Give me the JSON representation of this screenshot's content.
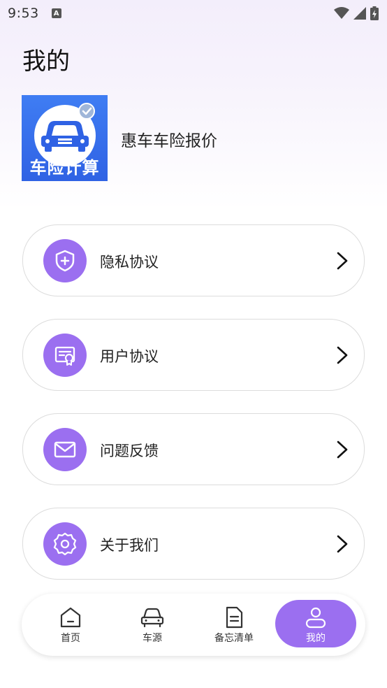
{
  "status_bar": {
    "time": "9:53",
    "notification_icon": "A"
  },
  "page": {
    "title": "我的"
  },
  "app": {
    "logo_text": "车险计算",
    "name": "惠车车险报价"
  },
  "menu": {
    "items": [
      {
        "label": "隐私协议",
        "icon": "shield-plus-icon"
      },
      {
        "label": "用户协议",
        "icon": "certificate-icon"
      },
      {
        "label": "问题反馈",
        "icon": "mail-icon"
      },
      {
        "label": "关于我们",
        "icon": "gear-icon"
      }
    ]
  },
  "bottom_nav": {
    "items": [
      {
        "label": "首页",
        "icon": "home-icon"
      },
      {
        "label": "车源",
        "icon": "car-icon"
      },
      {
        "label": "备忘清单",
        "icon": "document-icon"
      },
      {
        "label": "我的",
        "icon": "user-icon",
        "active": true
      }
    ]
  },
  "colors": {
    "accent": "#9b6ff0",
    "logo_blue": "#3a72ee"
  }
}
